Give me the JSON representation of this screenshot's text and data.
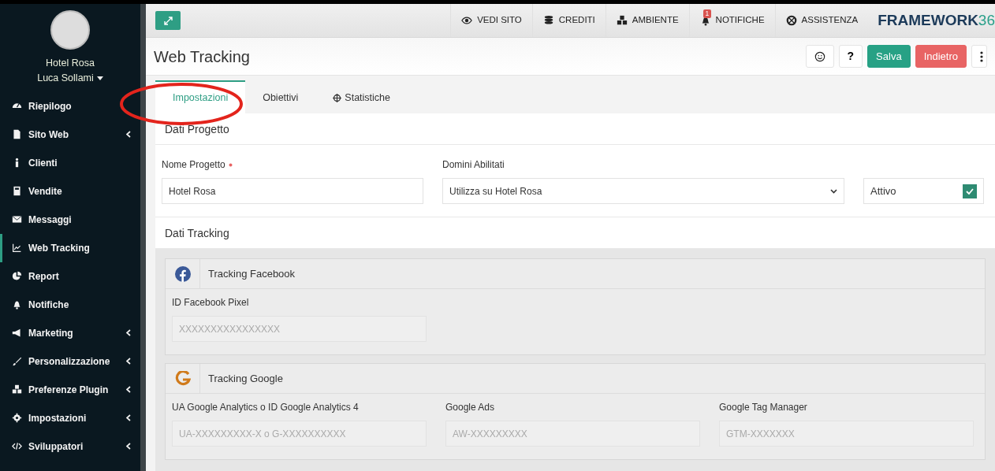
{
  "sidebar": {
    "profile": {
      "company": "Hotel Rosa",
      "user": "Luca Sollami"
    },
    "items": [
      {
        "label": "Riepilogo",
        "selected": false,
        "has_submenu": false
      },
      {
        "label": "Sito Web",
        "selected": false,
        "has_submenu": true
      },
      {
        "label": "Clienti",
        "selected": false,
        "has_submenu": false
      },
      {
        "label": "Vendite",
        "selected": false,
        "has_submenu": false
      },
      {
        "label": "Messaggi",
        "selected": false,
        "has_submenu": false
      },
      {
        "label": "Web Tracking",
        "selected": true,
        "has_submenu": false
      },
      {
        "label": "Report",
        "selected": false,
        "has_submenu": false
      },
      {
        "label": "Notifiche",
        "selected": false,
        "has_submenu": false
      },
      {
        "label": "Marketing",
        "selected": false,
        "has_submenu": true
      },
      {
        "label": "Personalizzazione",
        "selected": false,
        "has_submenu": true
      },
      {
        "label": "Preferenze Plugin",
        "selected": false,
        "has_submenu": true
      },
      {
        "label": "Impostazioni",
        "selected": false,
        "has_submenu": true
      },
      {
        "label": "Sviluppatori",
        "selected": false,
        "has_submenu": true
      }
    ]
  },
  "topbar": {
    "links": [
      {
        "label": "VEDI SITO"
      },
      {
        "label": "CREDITI"
      },
      {
        "label": "AMBIENTE"
      },
      {
        "label": "NOTIFICHE",
        "badge": "1"
      },
      {
        "label": "ASSISTENZA"
      }
    ],
    "logo": {
      "text": "FRAMEWORK",
      "accent": "36"
    }
  },
  "page": {
    "title": "Web Tracking",
    "buttons": [
      {
        "kind": "icon",
        "label": "?"
      },
      {
        "kind": "success",
        "label": "Salva"
      },
      {
        "kind": "danger",
        "label": "Indietro"
      }
    ]
  },
  "tabs": [
    {
      "label": "Impostazioni",
      "selected": true
    },
    {
      "label": "Obiettivi",
      "selected": false
    },
    {
      "label": "Statistiche",
      "selected": false
    }
  ],
  "project": {
    "title": "Dati Progetto",
    "name_field": {
      "label": "Nome Progetto",
      "required": true,
      "value": "Hotel Rosa"
    },
    "domains_field": {
      "label": "Domini Abilitati",
      "value": "Utilizza su Hotel Rosa"
    },
    "active": {
      "label": "Attivo",
      "checked": true
    }
  },
  "tracking": {
    "title": "Dati Tracking",
    "panels": [
      {
        "kind": "facebook",
        "title": "Tracking Facebook",
        "fields": [
          {
            "label": "ID Facebook Pixel",
            "placeholder": "XXXXXXXXXXXXXXXX"
          }
        ]
      },
      {
        "kind": "google",
        "title": "Tracking Google",
        "fields": [
          {
            "label": "UA Google Analytics o ID Google Analytics 4",
            "placeholder": "UA-XXXXXXXXX-X o G-XXXXXXXXXX"
          },
          {
            "label": "Google Ads",
            "placeholder": "AW-XXXXXXXXX"
          },
          {
            "label": "Google Tag Manager",
            "placeholder": "GTM-XXXXXXX"
          }
        ]
      }
    ]
  }
}
